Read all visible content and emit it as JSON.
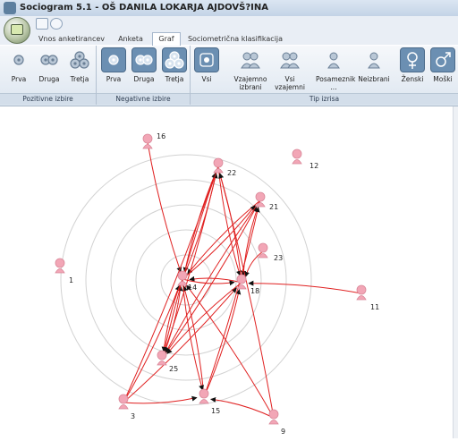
{
  "window": {
    "title": "Sociogram 5.1 - OŠ DANILA LOKARJA AJDOVŠ?INA"
  },
  "tabs": [
    {
      "label": "Vnos anketirancev"
    },
    {
      "label": "Anketa"
    },
    {
      "label": "Graf",
      "active": true
    },
    {
      "label": "Sociometrična klasifikacija"
    }
  ],
  "groups": {
    "positive": {
      "label": "Pozitivne izbire",
      "buttons": [
        "Prva",
        "Druga",
        "Tretja"
      ]
    },
    "negative": {
      "label": "Negativne izbire",
      "buttons": [
        "Prva",
        "Druga",
        "Tretja"
      ],
      "active": [
        0,
        1,
        2
      ]
    },
    "draw": {
      "label": "Tip izrisa",
      "buttons": [
        "Vsi",
        "Vzajemno izbrani",
        "Vsi vzajemni",
        "Posameznik ...",
        "Neizbrani",
        "Ženski",
        "Moški"
      ],
      "active": [
        0,
        5,
        6
      ]
    }
  },
  "colors": {
    "accent": "#6b8fb2",
    "edge": "#e02020",
    "node": "#f2a6b6",
    "ring": "#d2d2d2"
  },
  "graph": {
    "rings": 5,
    "nodes": [
      {
        "id": "16",
        "label": "16"
      },
      {
        "id": "22",
        "label": "22"
      },
      {
        "id": "12",
        "label": "12"
      },
      {
        "id": "21",
        "label": "21"
      },
      {
        "id": "23",
        "label": "23"
      },
      {
        "id": "1",
        "label": "1"
      },
      {
        "id": "14",
        "label": "14"
      },
      {
        "id": "18",
        "label": "18"
      },
      {
        "id": "11",
        "label": "11"
      },
      {
        "id": "25",
        "label": "25"
      },
      {
        "id": "3",
        "label": "3"
      },
      {
        "id": "15",
        "label": "15"
      },
      {
        "id": "9",
        "label": "9"
      }
    ],
    "edges": [
      [
        "16",
        "14"
      ],
      [
        "22",
        "14"
      ],
      [
        "14",
        "22"
      ],
      [
        "22",
        "18"
      ],
      [
        "18",
        "22"
      ],
      [
        "21",
        "14"
      ],
      [
        "14",
        "21"
      ],
      [
        "21",
        "18"
      ],
      [
        "23",
        "18"
      ],
      [
        "11",
        "18"
      ],
      [
        "18",
        "14"
      ],
      [
        "14",
        "18"
      ],
      [
        "25",
        "14"
      ],
      [
        "25",
        "22"
      ],
      [
        "25",
        "21"
      ],
      [
        "3",
        "14"
      ],
      [
        "3",
        "22"
      ],
      [
        "3",
        "15"
      ],
      [
        "3",
        "18"
      ],
      [
        "15",
        "18"
      ],
      [
        "15",
        "14"
      ],
      [
        "15",
        "21"
      ],
      [
        "9",
        "15"
      ],
      [
        "9",
        "14"
      ],
      [
        "9",
        "22"
      ],
      [
        "14",
        "25"
      ],
      [
        "18",
        "25"
      ],
      [
        "14",
        "15"
      ],
      [
        "22",
        "25"
      ],
      [
        "21",
        "25"
      ]
    ]
  }
}
